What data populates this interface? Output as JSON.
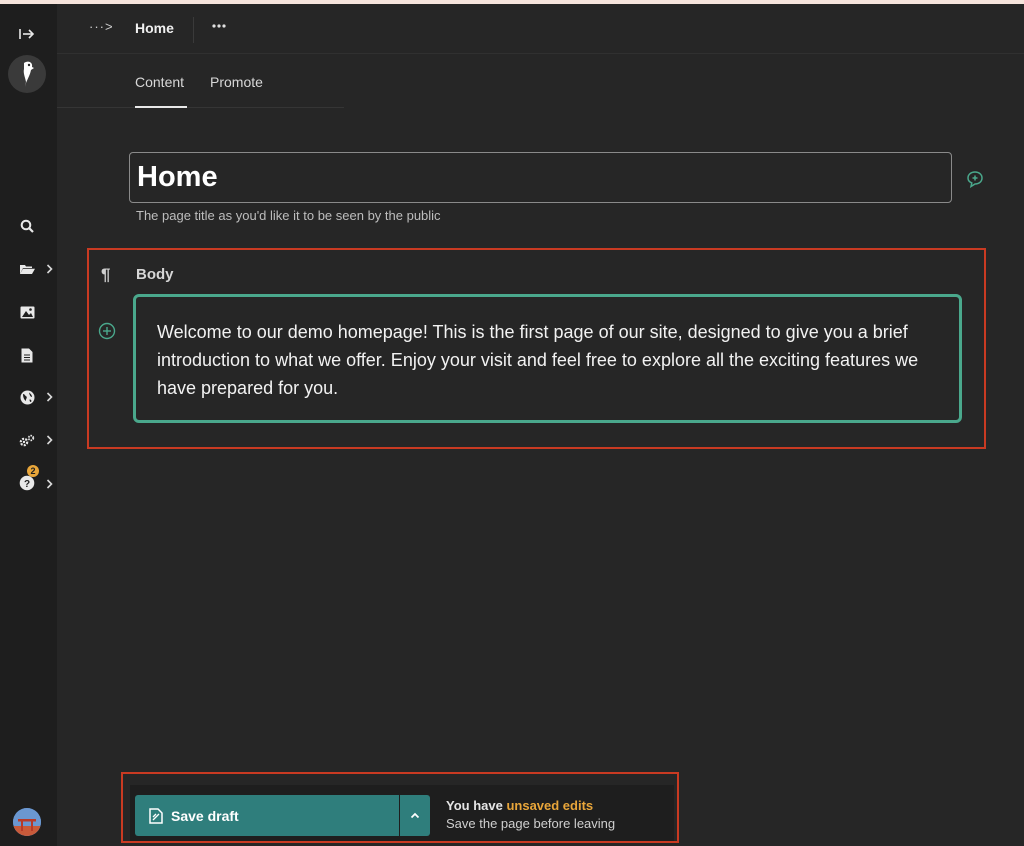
{
  "header": {
    "breadcrumb_toggle": "···>",
    "page_crumb": "Home"
  },
  "tabs": [
    {
      "label": "Content",
      "active": true
    },
    {
      "label": "Promote",
      "active": false
    }
  ],
  "title_field": {
    "value": "Home",
    "help_text": "The page title as you'd like it to be seen by the public"
  },
  "body_field": {
    "label": "Body",
    "text": "Welcome to our demo homepage! This is the first page of our site, designed to give you a brief introduction to what we offer. Enjoy your visit and feel free to explore all the exciting features we have prepared for you."
  },
  "sidebar": {
    "help_badge_count": "2",
    "icons": [
      "collapse-icon",
      "logo",
      "search-icon",
      "folder-icon",
      "image-icon",
      "document-icon",
      "globe-icon",
      "settings-icon",
      "help-icon"
    ]
  },
  "footer": {
    "save_label": "Save draft",
    "status_prefix": "You have ",
    "status_highlight": "unsaved edits",
    "status_sub": "Save the page before leaving"
  },
  "colors": {
    "accent_teal": "#2f7e7c",
    "focus_green": "#4aa88c",
    "warning_orange": "#e9a63a",
    "annotation_red": "#c93a22"
  }
}
